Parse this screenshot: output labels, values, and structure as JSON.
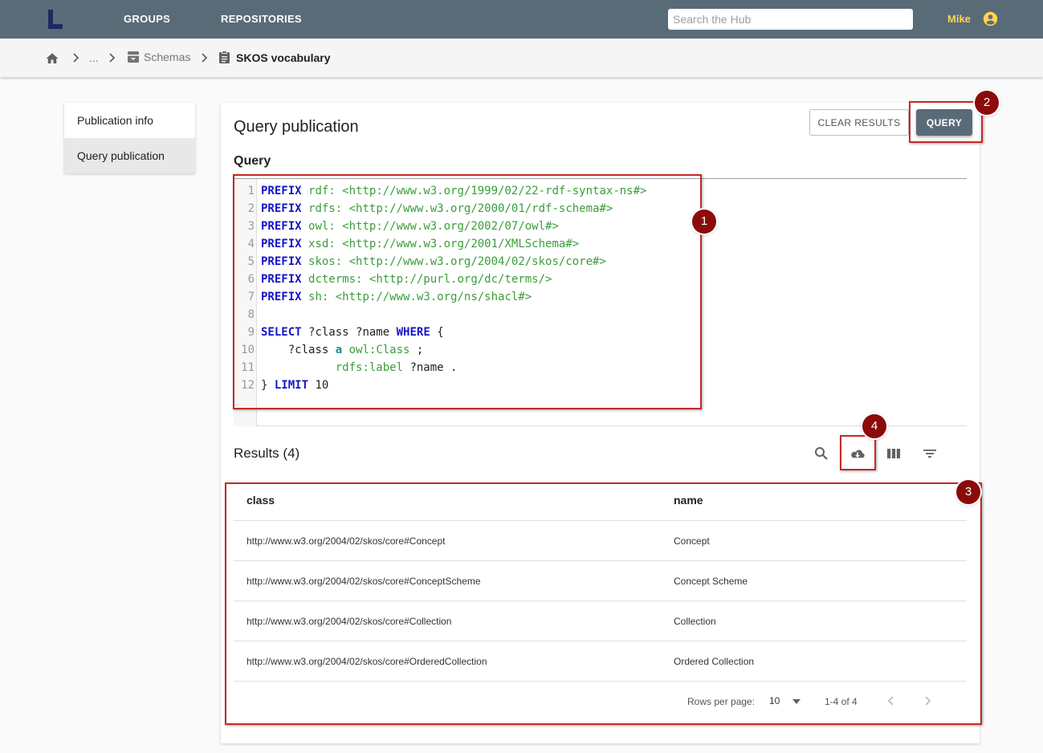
{
  "topbar": {
    "nav": [
      "GROUPS",
      "REPOSITORIES"
    ],
    "search_placeholder": "Search the Hub",
    "user": "Mike"
  },
  "breadcrumb": {
    "ellipsis": "...",
    "schemas": "Schemas",
    "current": "SKOS vocabulary"
  },
  "sidebar": {
    "items": [
      {
        "label": "Publication info",
        "active": false
      },
      {
        "label": "Query publication",
        "active": true
      }
    ]
  },
  "main": {
    "title": "Query publication",
    "clear_button": "CLEAR RESULTS",
    "query_button": "QUERY",
    "query_label": "Query"
  },
  "editor": {
    "line_numbers": [
      "1",
      "2",
      "3",
      "4",
      "5",
      "6",
      "7",
      "8",
      "9",
      "10",
      "11",
      "12"
    ],
    "lines": [
      {
        "kw": "PREFIX",
        "prefix": "rdf:",
        "iri": "<http://www.w3.org/1999/02/22-rdf-syntax-ns#>"
      },
      {
        "kw": "PREFIX",
        "prefix": "rdfs:",
        "iri": "<http://www.w3.org/2000/01/rdf-schema#>"
      },
      {
        "kw": "PREFIX",
        "prefix": "owl:",
        "iri": "<http://www.w3.org/2002/07/owl#>"
      },
      {
        "kw": "PREFIX",
        "prefix": "xsd:",
        "iri": "<http://www.w3.org/2001/XMLSchema#>"
      },
      {
        "kw": "PREFIX",
        "prefix": "skos:",
        "iri": "<http://www.w3.org/2004/02/skos/core#>"
      },
      {
        "kw": "PREFIX",
        "prefix": "dcterms:",
        "iri": "<http://purl.org/dc/terms/>"
      },
      {
        "kw": "PREFIX",
        "prefix": "sh:",
        "iri": "<http://www.w3.org/ns/shacl#>"
      }
    ],
    "select_line": {
      "kw": "SELECT",
      "vars": "?class ?name",
      "where": "WHERE",
      "brace": "{"
    },
    "line10": {
      "subj": "?class",
      "a": "a",
      "obj": "owl:Class",
      "end": ";"
    },
    "line11": {
      "pred": "rdfs:label",
      "obj": "?name",
      "end": "."
    },
    "line12": {
      "brace": "}",
      "limit": "LIMIT",
      "n": "10"
    }
  },
  "results": {
    "title": "Results (4)",
    "columns": [
      "class",
      "name"
    ],
    "rows": [
      [
        "http://www.w3.org/2004/02/skos/core#Concept",
        "Concept"
      ],
      [
        "http://www.w3.org/2004/02/skos/core#ConceptScheme",
        "Concept Scheme"
      ],
      [
        "http://www.w3.org/2004/02/skos/core#Collection",
        "Collection"
      ],
      [
        "http://www.w3.org/2004/02/skos/core#OrderedCollection",
        "Ordered Collection"
      ]
    ],
    "rows_per_page_label": "Rows per page:",
    "rows_per_page": "10",
    "range": "1-4 of 4"
  },
  "annotations": [
    "1",
    "2",
    "3",
    "4"
  ],
  "colors": {
    "topbar": "#5a6b78",
    "accent_user": "#ffd54f",
    "highlight": "#c62828",
    "badge": "#8b0b0b"
  }
}
